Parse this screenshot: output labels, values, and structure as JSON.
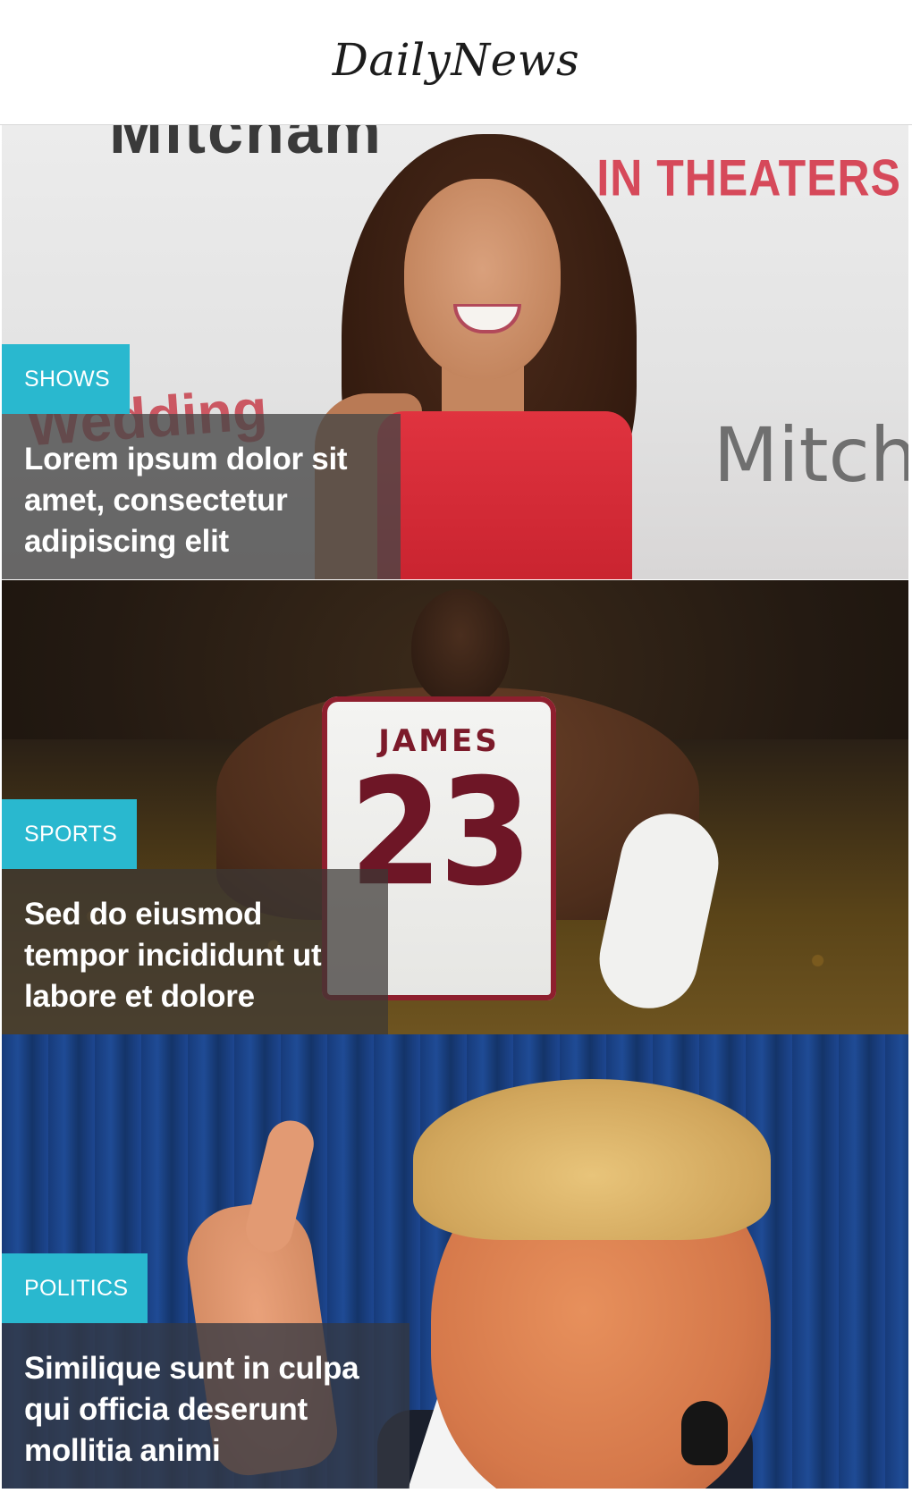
{
  "header": {
    "logo": "DailyNews"
  },
  "accent_color": "#29b8cf",
  "articles": [
    {
      "category": "SHOWS",
      "headline": "Lorem ipsum dolor sit amet, consectetur adipiscing elit",
      "image_text": {
        "backdrop_top": "Mitcham",
        "backdrop_banner": "IN THEATERS",
        "backdrop_side": "Mitch",
        "backdrop_logo": "Wedding"
      }
    },
    {
      "category": "SPORTS",
      "headline": "Sed do eiusmod tempor incididunt ut labore et dolore",
      "image_text": {
        "jersey_name": "JAMES",
        "jersey_number": "23"
      }
    },
    {
      "category": "POLITICS",
      "headline": "Similique sunt in culpa qui officia deserunt mollitia animi"
    }
  ]
}
